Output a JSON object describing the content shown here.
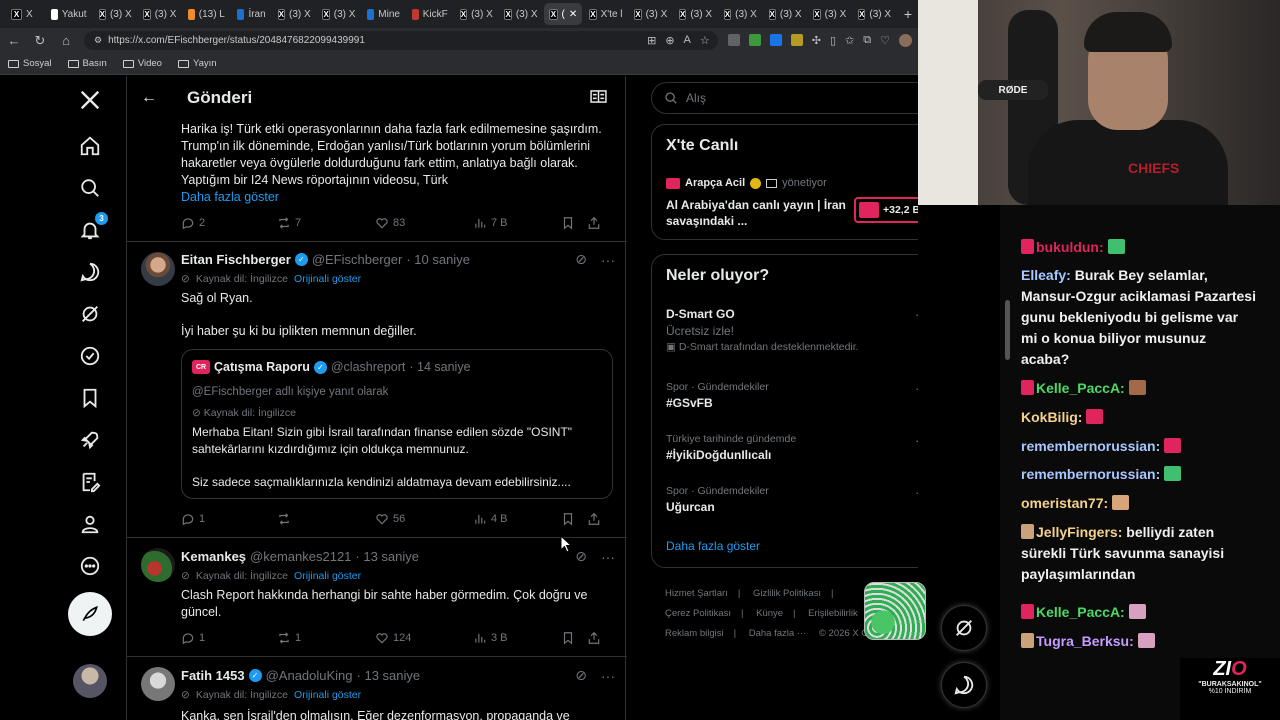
{
  "browser": {
    "tabs": [
      {
        "label": "X",
        "icon": "x"
      },
      {
        "label": "Yakut",
        "icon": "white"
      },
      {
        "label": "(3) X",
        "icon": "x"
      },
      {
        "label": "(3) X",
        "icon": "x"
      },
      {
        "label": "(13) L",
        "icon": "orange"
      },
      {
        "label": "İran",
        "icon": "blue"
      },
      {
        "label": "(3) X",
        "icon": "x"
      },
      {
        "label": "(3) X",
        "icon": "x"
      },
      {
        "label": "Mine",
        "icon": "blue"
      },
      {
        "label": "KickF",
        "icon": "red"
      },
      {
        "label": "(3) X",
        "icon": "x"
      },
      {
        "label": "(3) X",
        "icon": "x"
      },
      {
        "label": "(",
        "icon": "x",
        "active": true
      },
      {
        "label": "X'te l",
        "icon": "x"
      },
      {
        "label": "(3) X",
        "icon": "x"
      },
      {
        "label": "(3) X",
        "icon": "x"
      },
      {
        "label": "(3) X",
        "icon": "x"
      },
      {
        "label": "(3) X",
        "icon": "x"
      },
      {
        "label": "(3) X",
        "icon": "x"
      },
      {
        "label": "(3) X",
        "icon": "x"
      }
    ],
    "url": "https://x.com/EFischberger/status/2048476822099439991",
    "bookmarks": [
      "Sosyal",
      "Basın",
      "Video",
      "Yayın"
    ]
  },
  "main": {
    "title": "Gönderi",
    "tweet1": {
      "text": "Harika iş! Türk etki operasyonlarının daha fazla fark edilmemesine şaşırdım. Trump'ın ilk döneminde, Erdoğan yanlısı/Türk botlarının yorum bölümlerini hakaretler veya övgülerle doldurduğunu fark ettim, anlatıya bağlı olarak. Yaptığım bir I24 News röportajının videosu, Türk",
      "show_more": "Daha fazla göster",
      "replies": "2",
      "reposts": "7",
      "likes": "83",
      "views": "7 B"
    },
    "tweet2": {
      "name": "Eitan Fischberger",
      "handle": "@EFischberger",
      "time": "· 10 saniye",
      "source": "Kaynak dil: İngilizce",
      "show_original": "Orijinali göster",
      "line1": "Sağ ol Ryan.",
      "line2": "İyi haber şu ki bu iplikten memnun değiller.",
      "quote": {
        "name": "Çatışma Raporu",
        "handle": "@clashreport",
        "time": "· 14 saniye",
        "reply_to": "@EFischberger  adlı kişiye yanıt olarak",
        "source": "Kaynak dil: İngilizce",
        "text1": "Merhaba Eitan! Sizin gibi İsrail tarafından finanse edilen sözde \"OSINT\" sahtekârlarını kızdırdığımız için oldukça memnunuz.",
        "text2": "Siz sadece saçmalıklarınızla kendinizi aldatmaya devam edebilirsiniz...."
      },
      "replies": "1",
      "reposts": "",
      "likes": "56",
      "views": "4 B"
    },
    "tweet3": {
      "name": "Kemankeş",
      "handle": "@kemankes2121",
      "time": "· 13 saniye",
      "source": "Kaynak dil: İngilizce",
      "show_original": "Orijinali göster",
      "text": "Clash Report hakkında herhangi bir sahte haber görmedim. Çok doğru ve güncel.",
      "replies": "1",
      "reposts": "1",
      "likes": "124",
      "views": "3 B"
    },
    "tweet4": {
      "name": "Fatih 1453",
      "handle": "@AnadoluKing",
      "time": "· 13 saniye",
      "source": "Kaynak dil: İngilizce",
      "show_original": "Orijinali göster",
      "text": "Kanka, sen İsrail'den olmalısın. Eğer dezenformasyon, propaganda ve"
    }
  },
  "nav": {
    "notifications_badge": "3"
  },
  "sidebar": {
    "search_placeholder": "Alış",
    "live": {
      "title": "X'te Canlı",
      "host": "Arapça Acil",
      "managing": "yönetiyor",
      "headline": "Al Arabiya'dan canlı yayın | İran savaşındaki ...",
      "viewers": "+32,2 B"
    },
    "trends": {
      "title": "Neler oluyor?",
      "ad": {
        "name": "D-Smart GO",
        "desc": "Ücretsiz izle!",
        "sponsor": "D-Smart tarafından desteklenmektedir."
      },
      "items": [
        {
          "meta": "Spor · Gündemdekiler",
          "name": "#GSvFB"
        },
        {
          "meta": "Türkiye tarihinde gündemde",
          "name": "#İyikiDoğdunIlıcalı"
        },
        {
          "meta": "Spor · Gündemdekiler",
          "name": "Uğurcan"
        }
      ],
      "show_more": "Daha fazla göster"
    },
    "footer": {
      "terms": "Hizmet Şartları",
      "privacy": "Gizlilik Politikası",
      "cookies": "Çerez Politikası",
      "imprint": "Künye",
      "accessibility": "Erişilebilirlik",
      "ads": "Reklam bilgisi",
      "more": "Daha fazla ···",
      "copyright": "© 2026 X Corp."
    }
  },
  "stream": {
    "mic_label": "RØDE",
    "shirt_text": "CHIEFS",
    "chat": [
      {
        "user": "bukuldun:",
        "color": "#e0245e",
        "msg": ""
      },
      {
        "user": "Elleafy:",
        "color": "#a8c7ff",
        "msg": "Burak Bey selamlar, Mansur-Ozgur aciklamasi Pazartesi gunu bekleniyodu bi gelisme var mi o konua biliyor musunuz acaba?"
      },
      {
        "user": "Kelle_PaccA:",
        "color": "#4cd964",
        "msg": ""
      },
      {
        "user": "KokBilig:",
        "color": "#f5d28b",
        "msg": ""
      },
      {
        "user": "remembernorussian:",
        "color": "#a8c7ff",
        "msg": ""
      },
      {
        "user": "remembernorussian:",
        "color": "#a8c7ff",
        "msg": ""
      },
      {
        "user": "omeristan77:",
        "color": "#f5d28b",
        "msg": ""
      },
      {
        "user": "JellyFingers:",
        "color": "#f5d28b",
        "msg": "belliydi zaten sürekli Türk savunma sanayisi paylaşımlarından"
      },
      {
        "user": "Kelle_PaccA:",
        "color": "#4cd964",
        "msg": ""
      },
      {
        "user": "Tugra_Berksu:",
        "color": "#c69cff",
        "msg": ""
      }
    ],
    "promo": {
      "logo_a": "ZI",
      "logo_b": "O",
      "code": "\"BURAKSAKINOL\"",
      "discount": "%10 İNDİRİM"
    }
  }
}
